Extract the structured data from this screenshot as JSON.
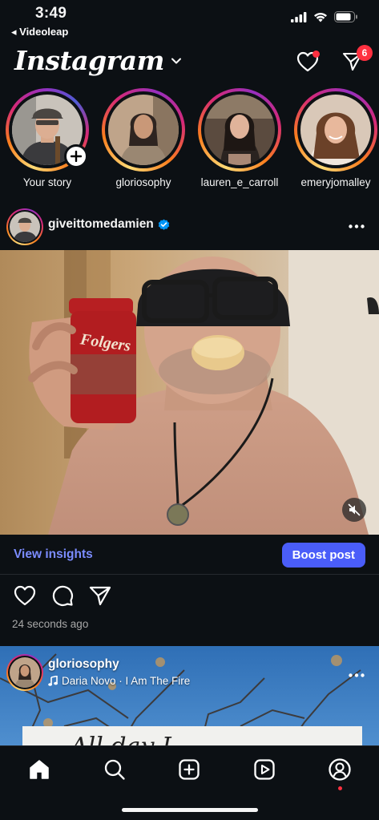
{
  "status_bar": {
    "time": "3:49",
    "back_app": "◂ Videoleap"
  },
  "header": {
    "brand": "Instagram",
    "dm_badge_count": "6"
  },
  "stories": [
    {
      "label": "Your story"
    },
    {
      "label": "gloriosophy"
    },
    {
      "label": "lauren_e_carroll"
    },
    {
      "label": "emeryjomalley"
    }
  ],
  "post": {
    "username": "giveittomedamien",
    "verified": true,
    "view_insights_label": "View insights",
    "boost_label": "Boost post",
    "timestamp": "24 seconds ago",
    "product_label": "Folgers"
  },
  "post2": {
    "username": "gloriosophy",
    "music": "Daria Novo · I Am The Fire",
    "card_text": "All day        I"
  },
  "colors": {
    "background": "#0c1014",
    "accent_link": "#7b8cff",
    "boost_button": "#4a5df9",
    "badge_red": "#ff3040"
  },
  "icons": {
    "header": [
      "chevron-down-icon",
      "heart-icon",
      "send-icon"
    ],
    "actions": [
      "heart-icon",
      "comment-icon",
      "share-icon"
    ],
    "nav": [
      "home-icon",
      "search-icon",
      "create-icon",
      "reels-icon",
      "profile-icon"
    ]
  }
}
